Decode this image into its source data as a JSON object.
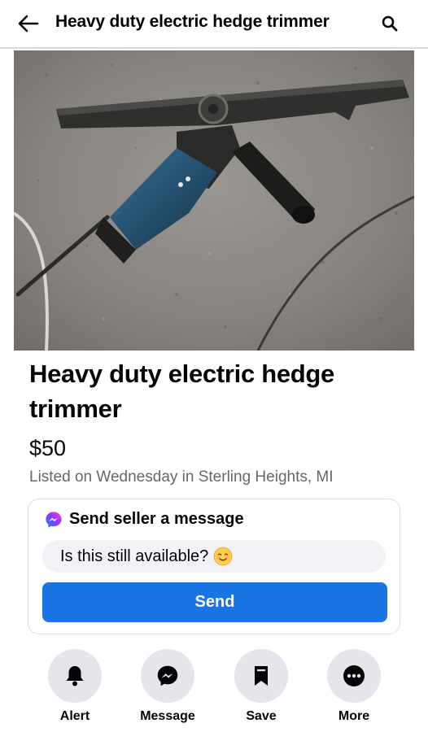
{
  "header": {
    "title": "Heavy duty electric hedge trimmer",
    "back_icon": "arrow-left-icon",
    "search_icon": "search-icon"
  },
  "listing": {
    "title": "Heavy duty electric hedge trimmer",
    "price": "$50",
    "listed": "Listed on Wednesday in Sterling Heights, MI"
  },
  "message_card": {
    "heading": "Send seller a message",
    "input_value": "Is this still available?",
    "send_label": "Send",
    "messenger_icon": "messenger-icon",
    "emoji_icon": "smiling-face-emoji"
  },
  "actions": [
    {
      "label": "Alert",
      "icon": "bell-icon"
    },
    {
      "label": "Message",
      "icon": "messenger-icon"
    },
    {
      "label": "Save",
      "icon": "bookmark-icon"
    },
    {
      "label": "More",
      "icon": "more-dots-icon"
    }
  ],
  "colors": {
    "accent": "#1b74e4",
    "secondary_text": "#65676b",
    "chip_background": "#e4e6eb"
  }
}
